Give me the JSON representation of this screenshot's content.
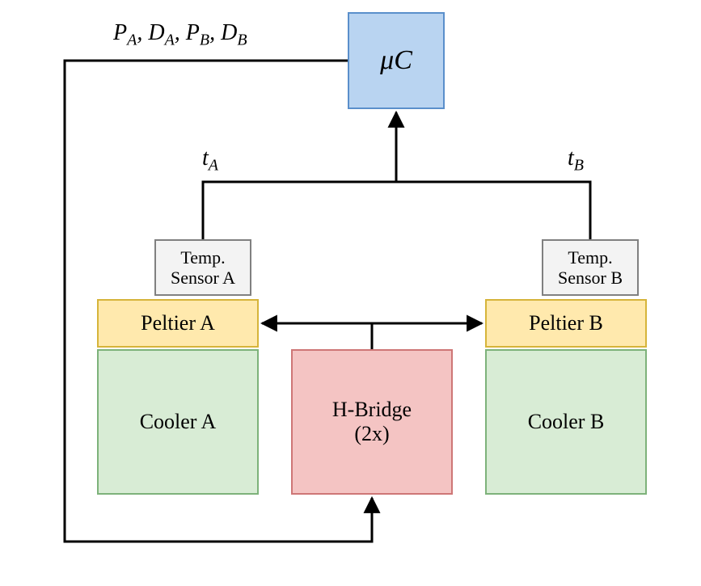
{
  "colors": {
    "uc_fill": "#b9d4f1",
    "uc_stroke": "#5a8fcb",
    "sensor_fill": "#f3f3f3",
    "sensor_stroke": "#808080",
    "peltier_fill": "#ffe9ad",
    "peltier_stroke": "#d6b43a",
    "cooler_fill": "#d8ecd5",
    "cooler_stroke": "#7db27a",
    "hbridge_fill": "#f4c4c3",
    "hbridge_stroke": "#ce7676",
    "line": "#000000"
  },
  "blocks": {
    "uc": {
      "label": "μC"
    },
    "sensor_a": {
      "line1": "Temp.",
      "line2": "Sensor A"
    },
    "sensor_b": {
      "line1": "Temp.",
      "line2": "Sensor B"
    },
    "peltier_a": {
      "label": "Peltier A"
    },
    "peltier_b": {
      "label": "Peltier B"
    },
    "cooler_a": {
      "label": "Cooler A"
    },
    "cooler_b": {
      "label": "Cooler B"
    },
    "hbridge": {
      "line1": "H-Bridge",
      "line2": "(2x)"
    }
  },
  "signals": {
    "t_a": {
      "var": "t",
      "sub": "A"
    },
    "t_b": {
      "var": "t",
      "sub": "B"
    },
    "pd_list": [
      {
        "var": "P",
        "sub": "A"
      },
      {
        "var": "D",
        "sub": "A"
      },
      {
        "var": "P",
        "sub": "B"
      },
      {
        "var": "D",
        "sub": "B"
      }
    ]
  }
}
